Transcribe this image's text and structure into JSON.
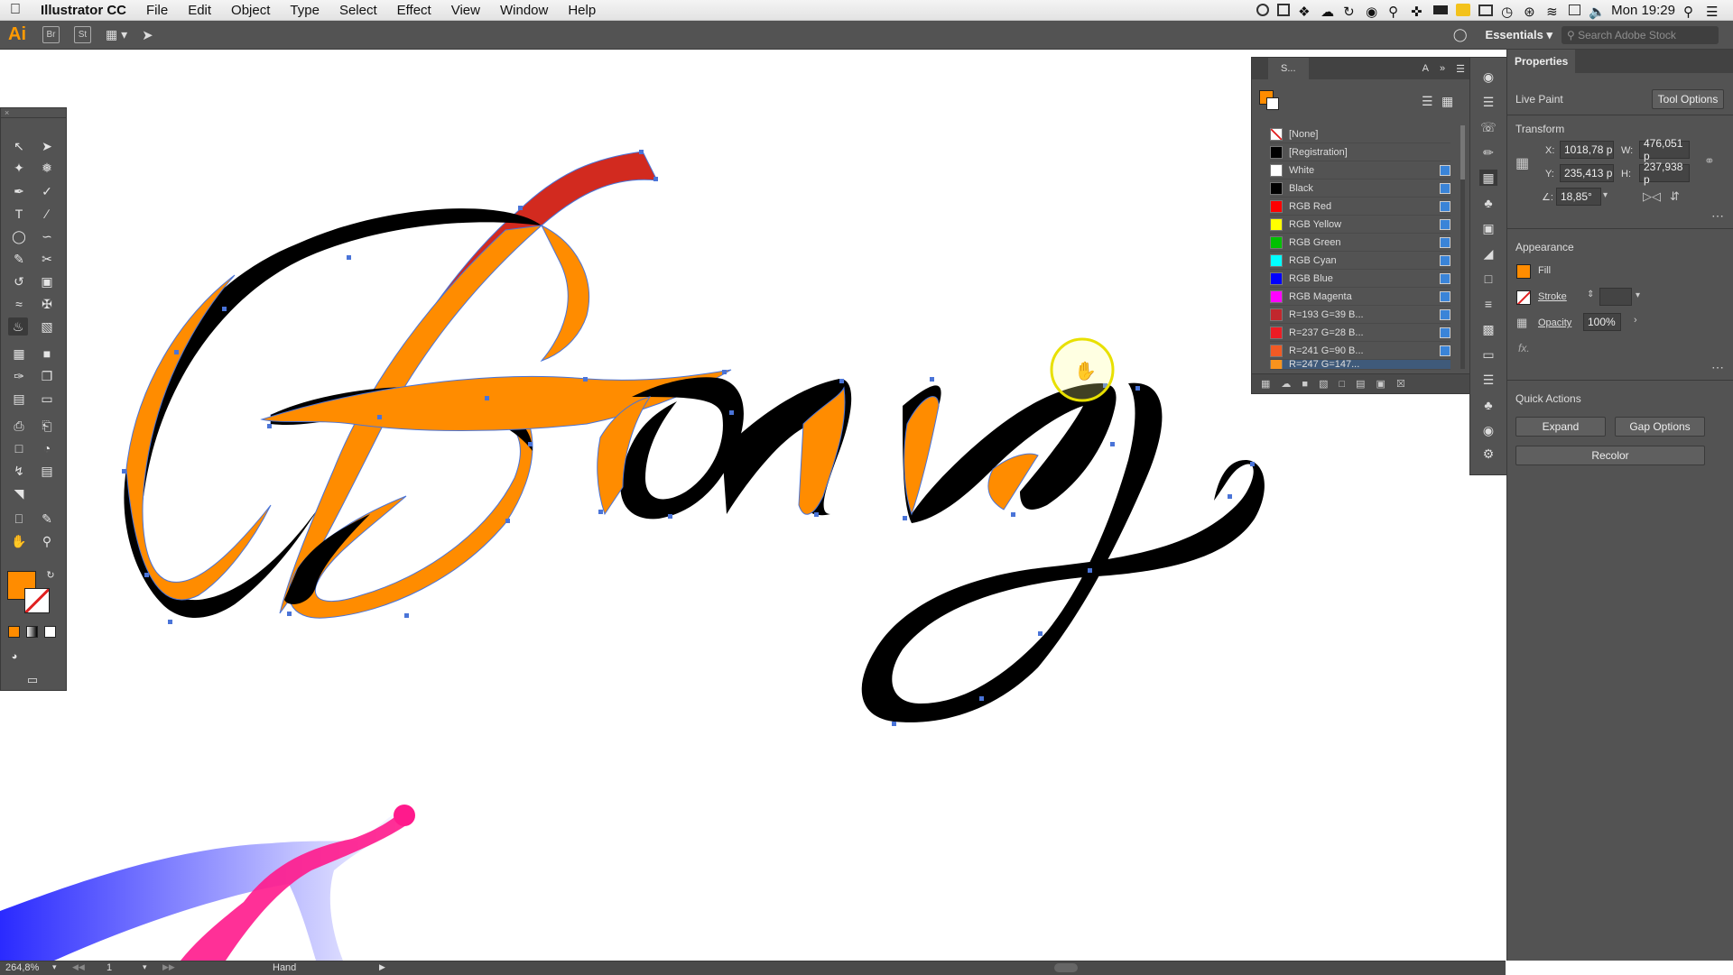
{
  "menubar": {
    "apple": "",
    "app_name": "Illustrator CC",
    "items": [
      "File",
      "Edit",
      "Object",
      "Type",
      "Select",
      "Effect",
      "View",
      "Window",
      "Help"
    ],
    "clock": "Mon 19:29"
  },
  "appbar": {
    "logo": "Ai",
    "br_label": "Br",
    "st_label": "St",
    "workspace": "Essentials",
    "search_placeholder": "Search Adobe Stock"
  },
  "canvas": {
    "artwork_text": "Bang"
  },
  "swatches": {
    "tab_label": "S...",
    "tab_label_2": "A",
    "items": [
      {
        "name": "[None]",
        "color": "none"
      },
      {
        "name": "[Registration]",
        "color": "#000000"
      },
      {
        "name": "White",
        "color": "#ffffff"
      },
      {
        "name": "Black",
        "color": "#000000"
      },
      {
        "name": "RGB Red",
        "color": "#ff0000"
      },
      {
        "name": "RGB Yellow",
        "color": "#ffff00"
      },
      {
        "name": "RGB Green",
        "color": "#00c000"
      },
      {
        "name": "RGB Cyan",
        "color": "#00ffff"
      },
      {
        "name": "RGB Blue",
        "color": "#0000ff"
      },
      {
        "name": "RGB Magenta",
        "color": "#ff00ff"
      },
      {
        "name": "R=193 G=39 B...",
        "color": "#c1272d"
      },
      {
        "name": "R=237 G=28 B...",
        "color": "#ed1c24"
      },
      {
        "name": "R=241 G=90 B...",
        "color": "#f15a24"
      },
      {
        "name": "R=247 G=147...",
        "color": "#f7931e"
      }
    ]
  },
  "properties": {
    "title": "Properties",
    "mode": "Live Paint",
    "tool_options": "Tool Options",
    "transform": {
      "section": "Transform",
      "x_label": "X:",
      "x": "1018,78 p",
      "y_label": "Y:",
      "y": "235,413 p",
      "w_label": "W:",
      "w": "476,051 p",
      "h_label": "H:",
      "h": "237,938 p",
      "angle_label": "∠:",
      "angle": "18,85°"
    },
    "appearance": {
      "section": "Appearance",
      "fill_label": "Fill",
      "stroke_label": "Stroke",
      "opacity_label": "Opacity",
      "opacity": "100%",
      "fx": "fx."
    },
    "quick_actions": {
      "section": "Quick Actions",
      "expand": "Expand",
      "gap_options": "Gap Options",
      "recolor": "Recolor"
    }
  },
  "status": {
    "zoom": "264,8%",
    "artboard": "1",
    "tool": "Hand"
  },
  "colors": {
    "fill_orange": "#ff8c00",
    "ribbon_red": "#d22a1f",
    "accent_blue": "#3a84d8",
    "badge_red": "#d01f1f"
  }
}
